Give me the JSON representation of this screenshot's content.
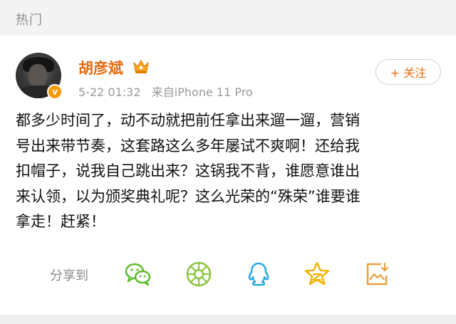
{
  "header": {
    "title": "热门"
  },
  "post": {
    "username": "胡彦斌",
    "time": "5-22 01:32",
    "source": "来自iPhone 11 Pro",
    "follow_label": "+ 关注",
    "verified_mark": "v",
    "content_lines": [
      "都多少时间了，动不动就把前任拿出来遛一遛，营销",
      "号出来带节奏，这套路这么多年屡试不爽啊！还给我",
      "扣帽子，说我自己跳出来？这锅我不背，谁愿意谁出",
      "来认领，以为颁奖典礼呢？这么光荣的“殊荣”谁要谁",
      "拿走！赶紧！"
    ]
  },
  "share": {
    "label": "分享到",
    "targets": [
      "wechat-icon",
      "moments-icon",
      "qq-icon",
      "qzone-icon",
      "save-image-icon"
    ]
  },
  "colors": {
    "accent": "#e86b0f",
    "wechat": "#5bbd2b",
    "moments": "#8cc63f",
    "qq": "#29a9e0",
    "qzone": "#f5b400",
    "save": "#e8a040"
  }
}
